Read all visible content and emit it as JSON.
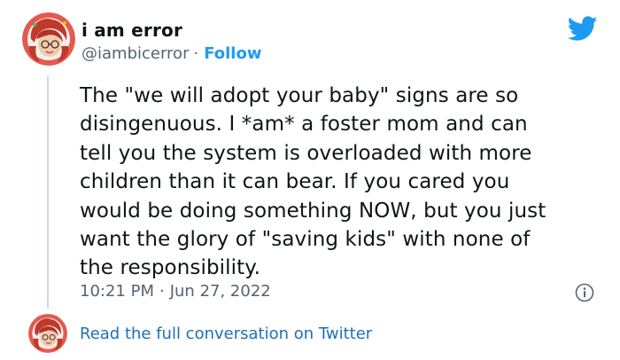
{
  "author": {
    "display_name": "i am error",
    "handle": "@iambicerror",
    "separator": "·",
    "follow_label": "Follow"
  },
  "tweet": {
    "text": "The \"we will adopt your baby\" signs are so\ndisingenuous. I *am* a foster mom and can\ntell you the system is overloaded with more\nchildren than it can bear. If you cared you\nwould be doing something NOW, but you just\nwant the glory of \"saving kids\" with none of\nthe responsibility.",
    "time": "10:21 PM",
    "separator": "·",
    "date": "Jun 27, 2022"
  },
  "footer": {
    "read_conversation_label": "Read the full conversation on Twitter"
  },
  "colors": {
    "accent": "#1d9bf0",
    "link": "#1d6fb8",
    "muted": "#536471",
    "thread_line": "#cfd9de"
  },
  "icons": {
    "brand": "twitter-bird-icon",
    "info": "info-icon"
  }
}
